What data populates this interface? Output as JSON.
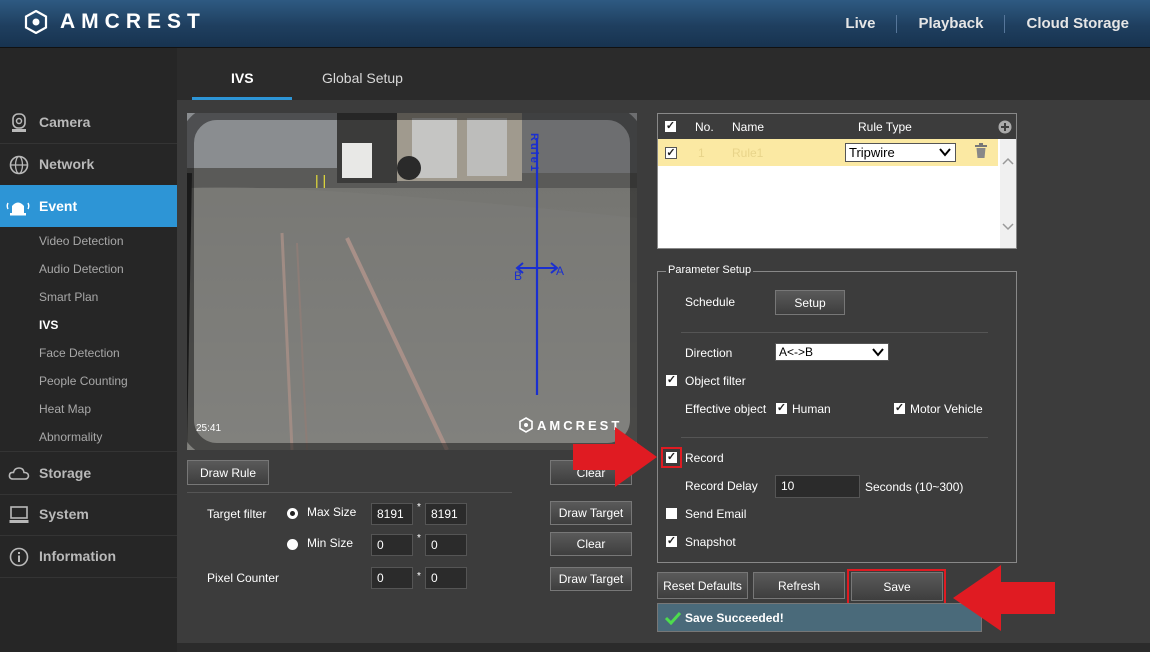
{
  "header": {
    "brand": "AMCREST",
    "nav": [
      "Live",
      "Playback",
      "Cloud Storage"
    ]
  },
  "sidebar": {
    "main": [
      {
        "label": "Camera",
        "icon": "camera-icon"
      },
      {
        "label": "Network",
        "icon": "globe-icon"
      },
      {
        "label": "Event",
        "icon": "alarm-icon",
        "active": true
      },
      {
        "label": "Storage",
        "icon": "cloud-icon"
      },
      {
        "label": "System",
        "icon": "monitor-icon"
      },
      {
        "label": "Information",
        "icon": "info-icon"
      }
    ],
    "sub": [
      "Video Detection",
      "Audio Detection",
      "Smart Plan",
      "IVS",
      "Face Detection",
      "People Counting",
      "Heat Map",
      "Abnormality"
    ],
    "active_sub": "IVS"
  },
  "tabs": [
    "IVS",
    "Global Setup"
  ],
  "video": {
    "watermark": "AMCREST",
    "timestamp": "25:41",
    "rule_label": "Rule1",
    "point_a": "A",
    "point_b": "B"
  },
  "left_controls": {
    "draw_rule": "Draw Rule",
    "clear": "Clear",
    "target_filter_label": "Target filter",
    "max_size_label": "Max Size",
    "max_w": "8191",
    "max_h": "8191",
    "min_size_label": "Min Size",
    "min_w": "0",
    "min_h": "0",
    "pixel_counter_label": "Pixel Counter",
    "px_w": "0",
    "px_h": "0",
    "star": "*",
    "draw_target": "Draw Target"
  },
  "rule_table": {
    "headers": {
      "no": "No.",
      "name": "Name",
      "type": "Rule Type"
    },
    "row": {
      "no": "1",
      "name": "Rule1",
      "type": "Tripwire"
    }
  },
  "params": {
    "legend": "Parameter Setup",
    "schedule_label": "Schedule",
    "setup_btn": "Setup",
    "direction_label": "Direction",
    "direction_value": "A<->B",
    "object_filter": "Object filter",
    "effective_object": "Effective object",
    "human": "Human",
    "motor_vehicle": "Motor Vehicle",
    "record": "Record",
    "record_delay_label": "Record Delay",
    "record_delay_value": "10",
    "record_delay_unit": "Seconds (10~300)",
    "send_email": "Send Email",
    "snapshot": "Snapshot"
  },
  "actions": {
    "reset": "Reset Defaults",
    "refresh": "Refresh",
    "save": "Save",
    "status": "Save Succeeded!"
  },
  "colors": {
    "accent": "#2d95d6",
    "highlight": "#e01b22",
    "row_selected": "#fbe9a3"
  }
}
